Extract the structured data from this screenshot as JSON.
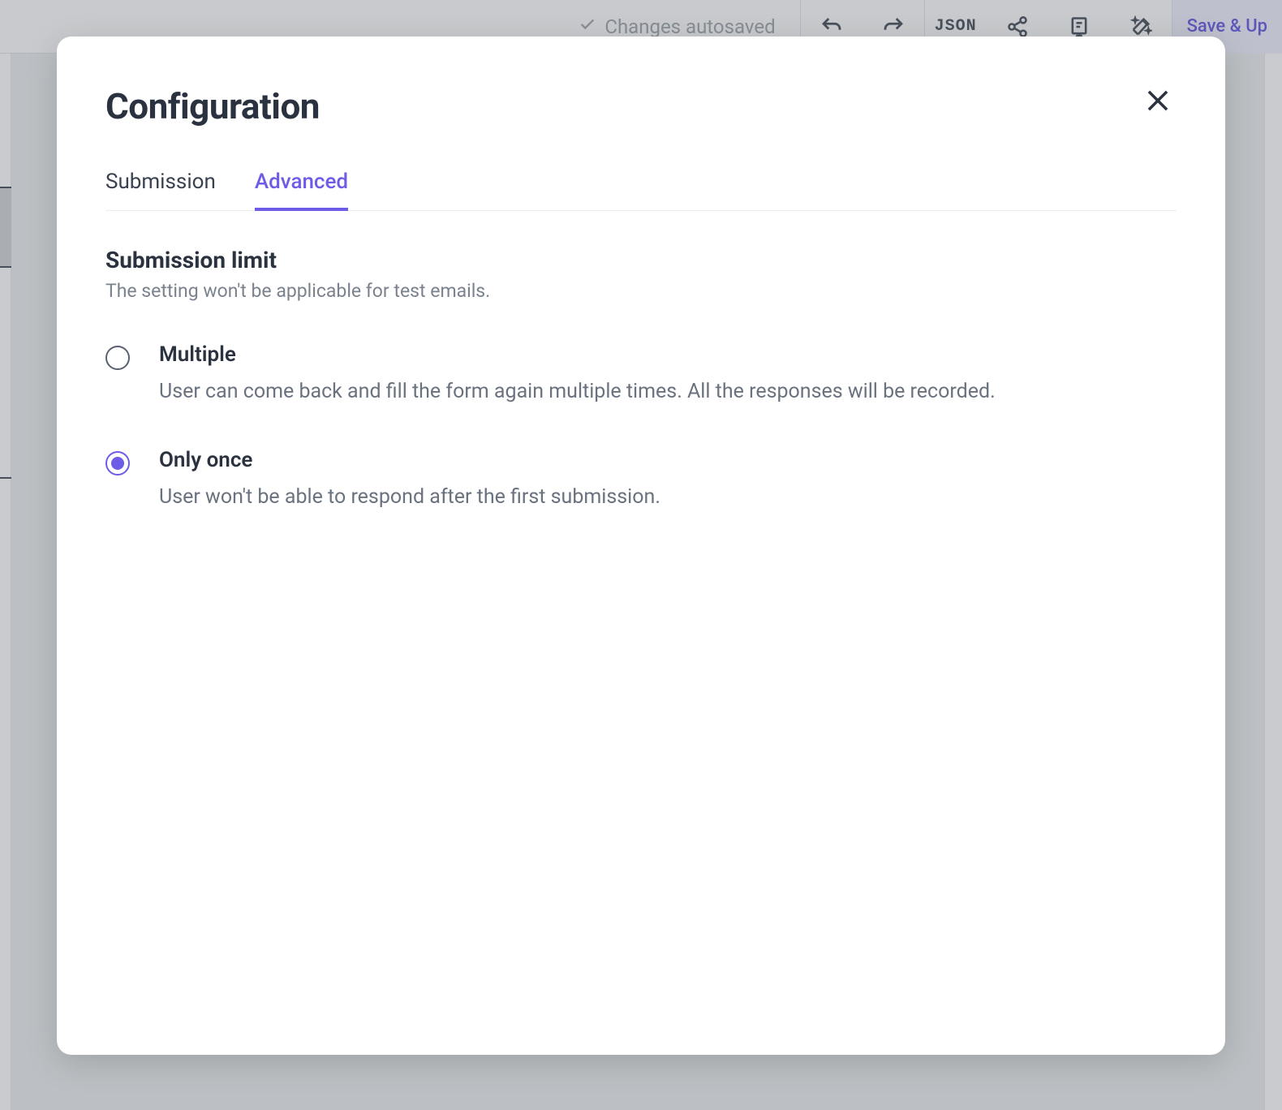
{
  "toolbar": {
    "autosave_label": "Changes autosaved",
    "json_label": "JSON",
    "save_button": "Save & Up"
  },
  "modal": {
    "title": "Configuration",
    "tabs": [
      {
        "label": "Submission",
        "active": false
      },
      {
        "label": "Advanced",
        "active": true
      }
    ],
    "section": {
      "title": "Submission limit",
      "description": "The setting won't be applicable for test emails."
    },
    "options": [
      {
        "label": "Multiple",
        "description": "User can come back and fill the form again multiple times. All the responses will be recorded.",
        "selected": false
      },
      {
        "label": "Only once",
        "description": "User won't be able to respond after the first submission.",
        "selected": true
      }
    ]
  }
}
